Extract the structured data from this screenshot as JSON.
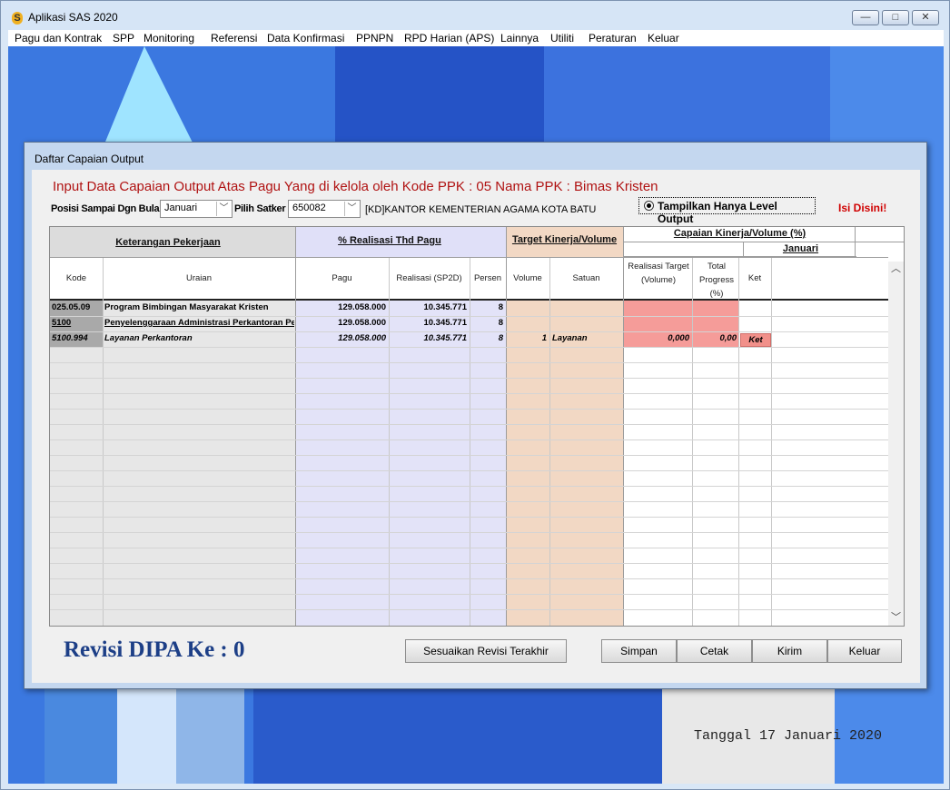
{
  "window": {
    "title": "Aplikasi SAS 2020",
    "icon_glyph": "S",
    "minimize_glyph": "—",
    "maximize_glyph": "□",
    "close_glyph": "✕"
  },
  "menu": [
    {
      "label": "Pagu dan Kontrak",
      "mnemonic": "P"
    },
    {
      "label": "SPP",
      "mnemonic": "S"
    },
    {
      "label": "Monitoring",
      "mnemonic": "M"
    },
    {
      "label": "Referensi",
      "mnemonic": "R"
    },
    {
      "label": "Data Konfirmasi",
      "mnemonic": "D"
    },
    {
      "label": "PPNPN",
      "mnemonic": "P"
    },
    {
      "label": "RPD Harian (APS)",
      "mnemonic": "R"
    },
    {
      "label": "Lainnya",
      "mnemonic": "L"
    },
    {
      "label": "Utiliti",
      "mnemonic": "U"
    },
    {
      "label": "Peraturan",
      "mnemonic": "P"
    },
    {
      "label": "Keluar",
      "mnemonic": "K"
    }
  ],
  "desktop": {
    "stamp_text": "Tanggal 17 Januari 2020"
  },
  "dialog": {
    "title": "Daftar Capaian Output",
    "headline": "Input Data Capaian Output Atas Pagu Yang di kelola oleh Kode PPK : 05 Nama PPK : Bimas Kristen",
    "filter": {
      "bulan_label": "Posisi Sampai Dgn Bulan",
      "bulan_value": "Januari",
      "satker_label": "Pilih Satker",
      "satker_value": "650082",
      "satker_name": "[KD]KANTOR KEMENTERIAN AGAMA KOTA BATU",
      "combo_arrow": "﹀",
      "radio_label": "Tampilkan Hanya Level Output",
      "radio_selected": true,
      "isi_disini": "Isi Disini!"
    },
    "grid": {
      "groups": {
        "keterangan": "Keterangan Pekerjaan",
        "realisasi": "% Realisasi Thd Pagu",
        "target": "Target Kinerja/Volume",
        "capaian": "Capaian Kinerja/Volume (%)",
        "bulan": "Januari"
      },
      "columns": {
        "kode": "Kode",
        "uraian": "Uraian",
        "pagu": "Pagu",
        "realisasi": "Realisasi (SP2D)",
        "persen": "Persen",
        "volume": "Volume",
        "satuan": "Satuan",
        "realisasi_target": "Realisasi Target (Volume)",
        "total_progress": "Total Progress (%)",
        "ket": "Ket"
      },
      "rows": [
        {
          "kode": "025.05.09",
          "uraian": "Program Bimbingan Masyarakat Kristen",
          "pagu": "129.058.000",
          "realisasi": "10.345.771",
          "persen": "8",
          "volume": "",
          "satuan": "",
          "realisasi_target": "",
          "total_progress": "",
          "ket": ""
        },
        {
          "kode": "5100",
          "uraian": "Penyelenggaraan Administrasi Perkantoran Pe",
          "pagu": "129.058.000",
          "realisasi": "10.345.771",
          "persen": "8",
          "volume": "",
          "satuan": "",
          "realisasi_target": "",
          "total_progress": "",
          "ket": ""
        },
        {
          "kode": "5100.994",
          "uraian": "Layanan Perkantoran",
          "pagu": "129.058.000",
          "realisasi": "10.345.771",
          "persen": "8",
          "volume": "1",
          "satuan": "Layanan",
          "realisasi_target": "0,000",
          "total_progress": "0,00",
          "ket": "Ket"
        }
      ],
      "scroll_up": "︿",
      "scroll_down": "﹀"
    },
    "revisi_label": "Revisi DIPA Ke : 0",
    "buttons": {
      "sesuaikan": "Sesuaikan Revisi Terakhir",
      "simpan": "Simpan",
      "cetak": "Cetak",
      "kirim": "Kirim",
      "keluar": "Keluar"
    }
  },
  "colors": {
    "realisasi_col": "#e3e3f8",
    "target_col": "#f2d8c4",
    "capaian_input": "#f59c99",
    "kode_bg": "#a9a9a9",
    "headline": "#b01212",
    "revisi": "#1d3f87"
  }
}
